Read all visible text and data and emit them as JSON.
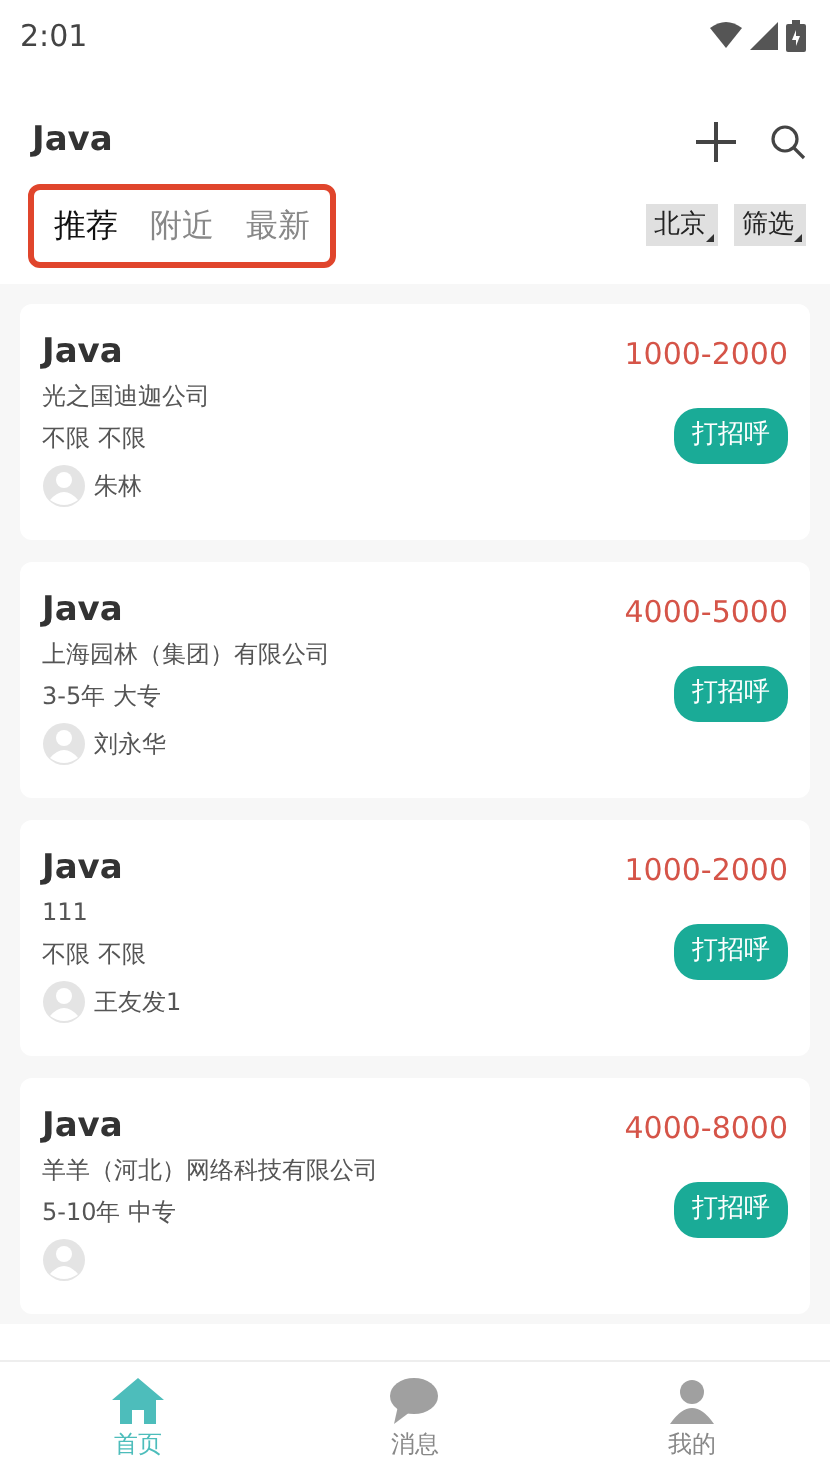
{
  "status_bar": {
    "time": "2:01"
  },
  "header": {
    "title": "Java"
  },
  "tabs": [
    {
      "label": "推荐",
      "selected": true
    },
    {
      "label": "附近",
      "selected": false
    },
    {
      "label": "最新",
      "selected": false
    }
  ],
  "filters": [
    {
      "label": "北京"
    },
    {
      "label": "筛选"
    }
  ],
  "jobs": [
    {
      "title": "Java",
      "salary": "1000-2000",
      "company": "光之国迪迦公司",
      "experience": "不限",
      "education": "不限",
      "recruiter": "朱林",
      "action": "打招呼"
    },
    {
      "title": "Java",
      "salary": "4000-5000",
      "company": "上海园林（集团）有限公司",
      "experience": "3-5年",
      "education": "大专",
      "recruiter": "刘永华",
      "action": "打招呼"
    },
    {
      "title": "Java",
      "salary": "1000-2000",
      "company": "111",
      "experience": "不限",
      "education": "不限",
      "recruiter": "王友发1",
      "action": "打招呼"
    },
    {
      "title": "Java",
      "salary": "4000-8000",
      "company": "羊羊（河北）网络科技有限公司",
      "experience": "5-10年",
      "education": "中专",
      "action": "打招呼"
    }
  ],
  "bottom_nav": [
    {
      "label": "首页",
      "kind": "home",
      "selected": true
    },
    {
      "label": "消息",
      "kind": "message",
      "selected": false
    },
    {
      "label": "我的",
      "kind": "profile",
      "selected": false
    }
  ]
}
